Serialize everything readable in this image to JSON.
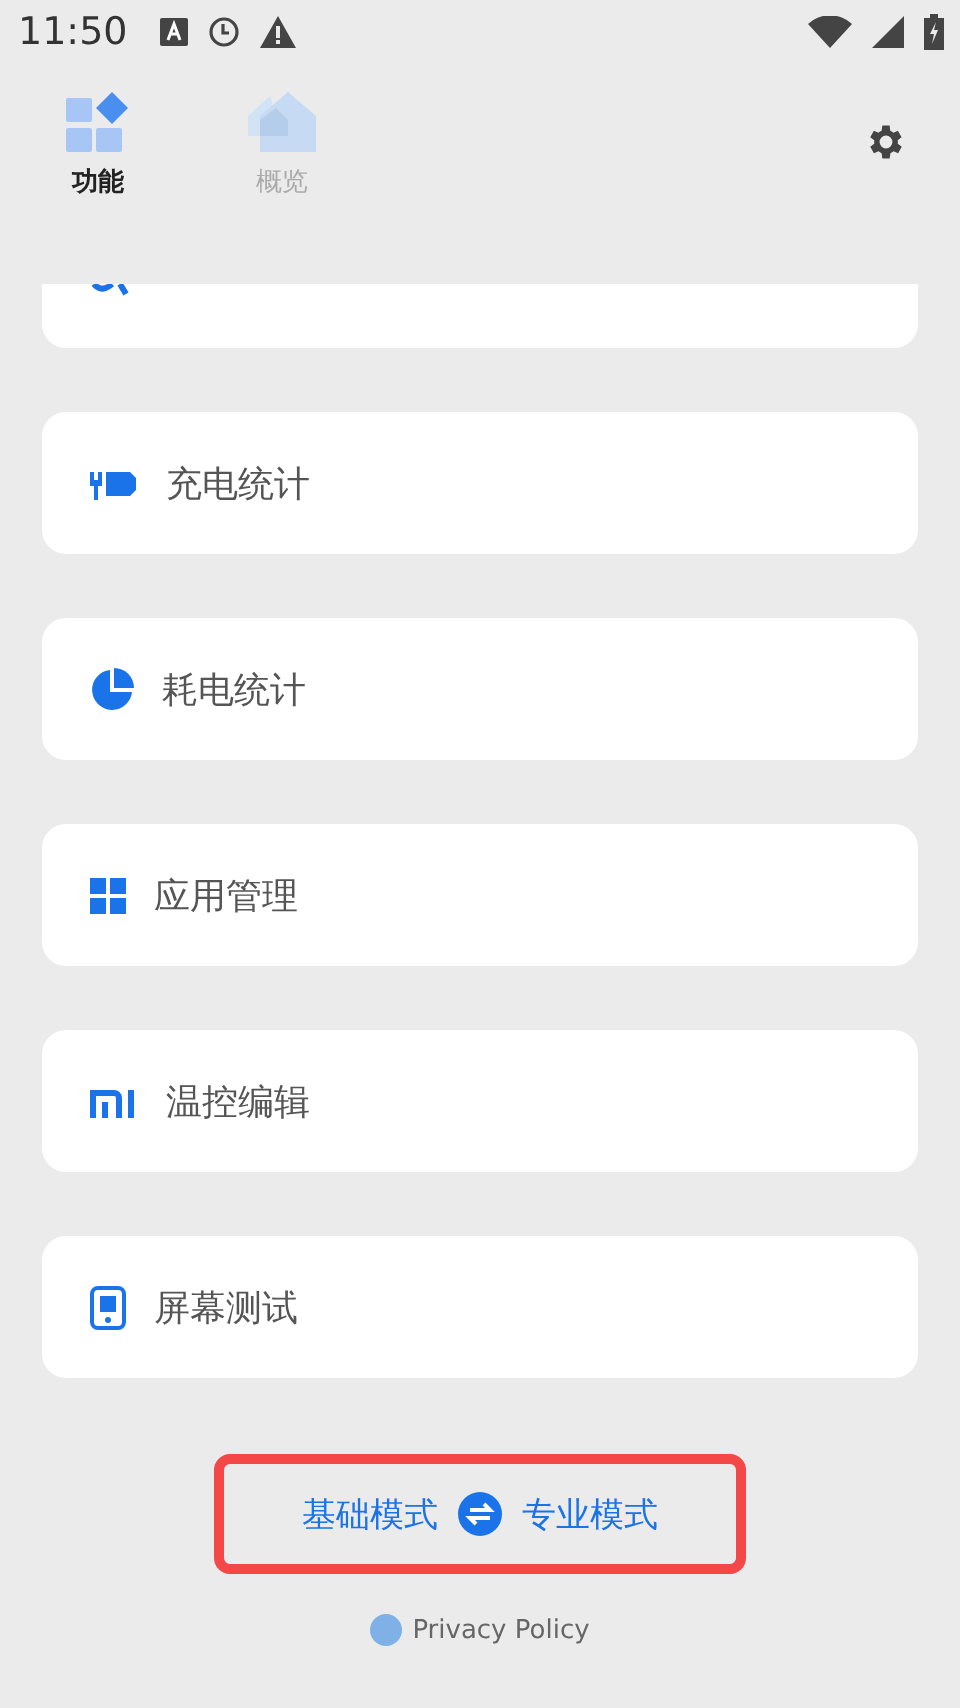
{
  "status_bar": {
    "time": "11:50"
  },
  "tabs": [
    {
      "label": "功能",
      "kind": "grid",
      "selected": true
    },
    {
      "label": "概览",
      "kind": "home",
      "selected": false
    }
  ],
  "menu_items": [
    {
      "label": "充电统计",
      "kind": "charge"
    },
    {
      "label": "耗电统计",
      "kind": "pie"
    },
    {
      "label": "应用管理",
      "kind": "apps"
    },
    {
      "label": "温控编辑",
      "kind": "mi"
    },
    {
      "label": "屏幕测试",
      "kind": "phone"
    }
  ],
  "mode_switch": {
    "left": "基础模式",
    "right": "专业模式",
    "highlighted": true
  },
  "footer": {
    "link": "Privacy Policy"
  }
}
